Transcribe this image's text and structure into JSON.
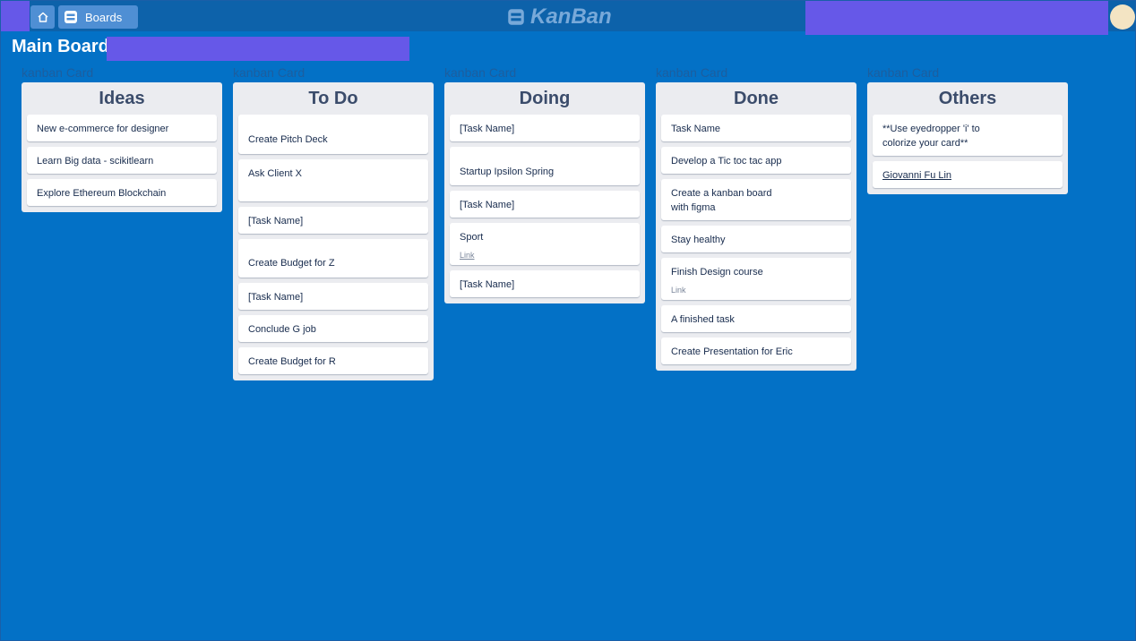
{
  "topbar": {
    "boards_label": "Boards",
    "brand": "KanBan"
  },
  "board": {
    "title": "Main Board"
  },
  "lists": [
    {
      "caption": "kanban Card",
      "title": "Ideas",
      "cards": [
        {
          "text": "New e-commerce for designer"
        },
        {
          "text": "Learn Big data - scikitlearn"
        },
        {
          "text": "Explore Ethereum Blockchain"
        }
      ]
    },
    {
      "caption": "kanban Card",
      "title": "To Do",
      "cards": [
        {
          "text": "Create Pitch Deck"
        },
        {
          "text": "Ask Client X"
        },
        {
          "text": "[Task Name]"
        },
        {
          "text": "Create Budget for Z"
        },
        {
          "text": "[Task Name]"
        },
        {
          "text": "Conclude G job"
        },
        {
          "text": "Create Budget for R"
        }
      ]
    },
    {
      "caption": "kanban Card",
      "title": "Doing",
      "cards": [
        {
          "text": "[Task Name]"
        },
        {
          "text": "Startup Ipsilon Spring"
        },
        {
          "text": "[Task Name]"
        },
        {
          "text": "Sport",
          "link": "Link"
        },
        {
          "text": "[Task Name]"
        }
      ]
    },
    {
      "caption": "kanban Card",
      "title": "Done",
      "cards": [
        {
          "text": "Task Name"
        },
        {
          "text": "Develop a Tic toc tac app"
        },
        {
          "text": "Create a kanban board with figma"
        },
        {
          "text": "Stay healthy"
        },
        {
          "text": "Finish Design course",
          "link": "Link"
        },
        {
          "text": "A finished task"
        },
        {
          "text": "Create Presentation for Eric"
        }
      ]
    },
    {
      "caption": "kanban Card",
      "title": "Others",
      "cards": [
        {
          "text": "**Use eyedropper 'i' to colorize your card**"
        },
        {
          "text": "Giovanni Fu Lin"
        }
      ]
    }
  ],
  "colors": {
    "background": "#0371c6",
    "accent_purple": "#6658e8",
    "list_bg": "#ebecf0",
    "avatar": "#f3e4c3"
  }
}
